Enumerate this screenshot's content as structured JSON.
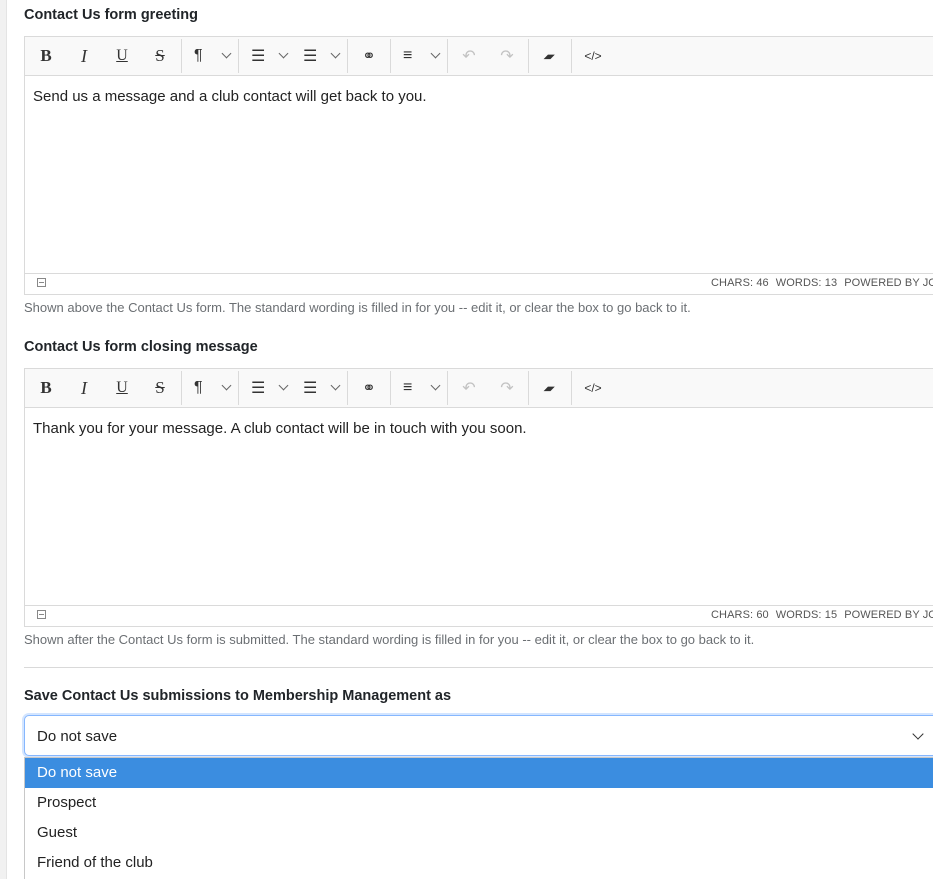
{
  "greeting": {
    "label": "Contact Us form greeting",
    "content": "Send us a message and a club contact will get back to you.",
    "chars": "CHARS: 46",
    "words": "WORDS: 13",
    "powered": "POWERED BY JODIT",
    "help": "Shown above the Contact Us form. The standard wording is filled in for you -- edit it, or clear the box to go back to it."
  },
  "closing": {
    "label": "Contact Us form closing message",
    "content": "Thank you for your message. A club contact will be in touch with you soon.",
    "chars": "CHARS: 60",
    "words": "WORDS: 15",
    "powered": "POWERED BY JODIT",
    "help": "Shown after the Contact Us form is submitted. The standard wording is filled in for you -- edit it, or clear the box to go back to it."
  },
  "toolbar": {
    "bold": "B",
    "italic": "I",
    "underline": "U",
    "strike": "S",
    "paragraph": "¶",
    "ul": "☰",
    "ol": "☰",
    "link": "⚭",
    "align": "≡",
    "undo": "↶",
    "redo": "↷",
    "eraser": "▰",
    "source": "</>"
  },
  "save_as": {
    "label": "Save Contact Us submissions to Membership Management as",
    "selected": "Do not save",
    "options": [
      "Do not save",
      "Prospect",
      "Guest",
      "Friend of the club"
    ]
  },
  "colors": {
    "highlight": "#3b8de0",
    "focus_border": "#86b7fe"
  }
}
